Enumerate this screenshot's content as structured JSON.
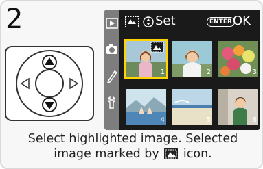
{
  "step_number": "2",
  "lcd": {
    "header_label": "Set",
    "ok_button": {
      "enter_label": "ENTER",
      "ok_label": "OK"
    },
    "side_tabs": [
      "playback-icon",
      "camera-icon",
      "pencil-icon",
      "wrench-icon"
    ],
    "thumbnails": [
      {
        "number": "1",
        "selected": true,
        "has_print_mark": true
      },
      {
        "number": "2",
        "selected": false
      },
      {
        "number": "3",
        "selected": false
      },
      {
        "number": "4",
        "selected": false
      },
      {
        "number": "5",
        "selected": false
      },
      {
        "number": "6",
        "selected": false
      }
    ]
  },
  "caption": {
    "line1": "Select highlighted image.  Selected",
    "line2_before": "image marked by",
    "line2_after": "icon."
  }
}
